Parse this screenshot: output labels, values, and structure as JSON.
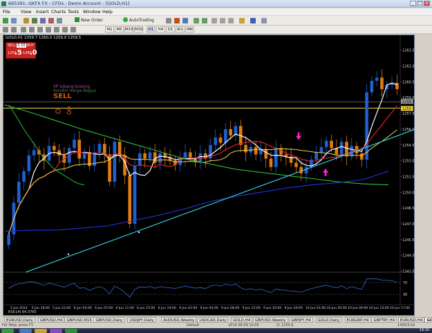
{
  "window": {
    "title": "665391: GKFX FX - CFDs - Demo Account - [GOLD,H1]"
  },
  "menu": [
    "File",
    "View",
    "Insert",
    "Charts",
    "Tools",
    "Window",
    "Help"
  ],
  "toolbar": {
    "new_order": "New Order",
    "autotrading": "AutoTrading",
    "timeframes": [
      "M1",
      "M5",
      "M15",
      "M30",
      "H1",
      "H4",
      "D1",
      "W1",
      "MN"
    ]
  },
  "chart": {
    "header": "GOLD,H1  1259.7 1260.0 1259.0 1259.5",
    "trade": {
      "sell": "SELL",
      "buy": "BUY",
      "lot": "0.10",
      "bid_prefix": "1259",
      "bid_big": ".5",
      "ask_prefix": "1260",
      "ask_big": ".0"
    },
    "annotations": {
      "a1": "0P lubang kosong",
      "a2": "Kondisi Harga Bagus",
      "a3": "SELL"
    },
    "price_labels": [
      "1263.5",
      "1262.0",
      "1260.5",
      "1259.0",
      "1257.5",
      "1256.0",
      "1254.5",
      "1253.0",
      "1251.5",
      "1250.0",
      "1248.5",
      "1247.0",
      "1245.5",
      "1244.0",
      "1242.5"
    ],
    "price_tags": {
      "hline1": "1258.5",
      "current": "1259.5"
    },
    "time_labels": [
      "5 Jun 2014",
      "5 Jun 18:00",
      "5 Jun 22:00",
      "6 Jun 03:00",
      "6 Jun 07:00",
      "6 Jun 11:00",
      "6 Jun 15:00",
      "6 Jun 19:00",
      "9 Jun 01:00",
      "9 Jun 04:00",
      "9 Jun 08:00",
      "9 Jun 12:00",
      "9 Jun 16:00",
      "9 Jun 20:00",
      "10 Jun 01:00",
      "10 Jun 05:00",
      "10 Jun 09:00",
      "10 Jun 13:00",
      "10 Jun 17:00"
    ],
    "rsi_label": "RSI(14) 64.3765",
    "rsi_levels": [
      "70",
      "30"
    ],
    "colors": {
      "bull": "#1f5fcf",
      "bear": "#e07a12",
      "ma_white": "#ffffff",
      "ma_red": "#e0202a",
      "ma_yellow": "#f2d640",
      "ma_green": "#2fbf3a",
      "ma_blue": "#2233dd",
      "trend_cyan": "#33ccdd",
      "arrows": "#ff22cc"
    }
  },
  "tabs": [
    "EURUSD,Daily",
    "GBPUSD,H4",
    "GBPUSD,M15",
    "GBPUSD,Daily",
    "USDJPY,Daily",
    "AUDUSD,Weekly",
    "USDCAD,Daily",
    "GOLD,H4",
    "GBPUSD,Weekly",
    "GBPJPY,H4",
    "GOLD,Daily",
    "EURGBP,H4",
    "GBPTRY,H4",
    "EURUSD,H4",
    "GOLD,H1"
  ],
  "status": {
    "left": "For Help, press F1",
    "profile": "Default",
    "time": "2014.06.09 10:00",
    "open": "O: 1255.6",
    "kb": "1305/3 kb"
  },
  "taskbar": {
    "clock": "19:10"
  }
}
